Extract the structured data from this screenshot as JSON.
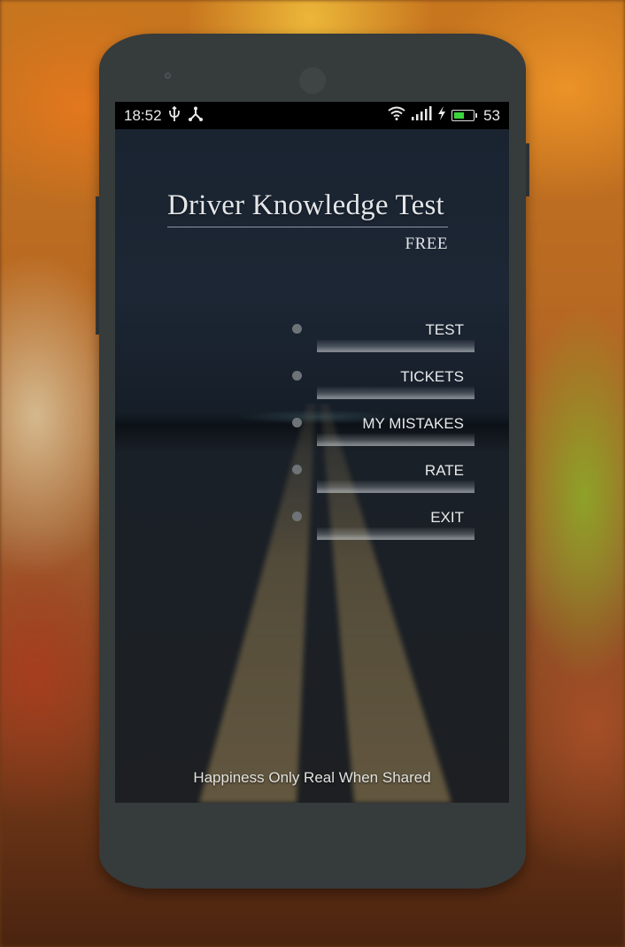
{
  "status_bar": {
    "time": "18:52",
    "left_icons": [
      "usb-icon",
      "share-icon"
    ],
    "right_icons": [
      "wifi-icon",
      "signal-icon",
      "charging-icon",
      "battery-icon"
    ],
    "battery_level": "53",
    "battery_fraction": 0.53,
    "battery_color": "#3bd43b"
  },
  "app": {
    "title": "Driver Knowledge Test",
    "subtitle": "FREE",
    "menu": [
      {
        "label": "TEST"
      },
      {
        "label": "TICKETS"
      },
      {
        "label": "MY MISTAKES"
      },
      {
        "label": "RATE"
      },
      {
        "label": "EXIT"
      }
    ],
    "footer": "Happiness Only Real When Shared"
  },
  "icons": {
    "usb": "ψ",
    "share": "⅄",
    "wifi": "◠",
    "signal": "ıll",
    "charging": "ϟ"
  }
}
